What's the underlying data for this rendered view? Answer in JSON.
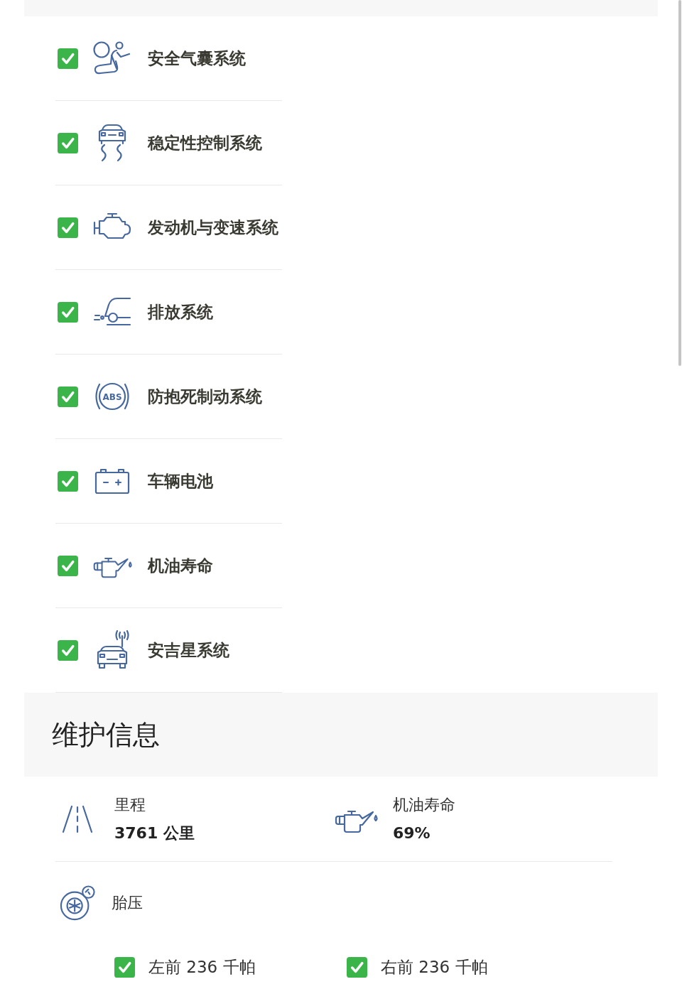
{
  "system_checks": [
    {
      "label": "安全气囊系统",
      "kind": "airbag",
      "checked": true
    },
    {
      "label": "稳定性控制系统",
      "kind": "stability",
      "checked": true
    },
    {
      "label": "发动机与变速系统",
      "kind": "engine",
      "checked": true
    },
    {
      "label": "排放系统",
      "kind": "emissions",
      "checked": true
    },
    {
      "label": "防抱死制动系统",
      "kind": "abs",
      "icon_text": "ABS",
      "checked": true
    },
    {
      "label": "车辆电池",
      "kind": "battery",
      "checked": true
    },
    {
      "label": "机油寿命",
      "kind": "oil",
      "checked": true
    },
    {
      "label": "安吉星系统",
      "kind": "onstar",
      "checked": true
    }
  ],
  "maintenance": {
    "title": "维护信息",
    "stats": [
      {
        "kind": "mileage",
        "label": "里程",
        "value": "3761 公里"
      },
      {
        "kind": "oil",
        "label": "机油寿命",
        "value": "69%"
      }
    ],
    "tire_pressure": {
      "label": "胎压",
      "readings": [
        {
          "text": "左前 236 千帕",
          "checked": true
        },
        {
          "text": "右前 236 千帕",
          "checked": true
        }
      ]
    }
  }
}
